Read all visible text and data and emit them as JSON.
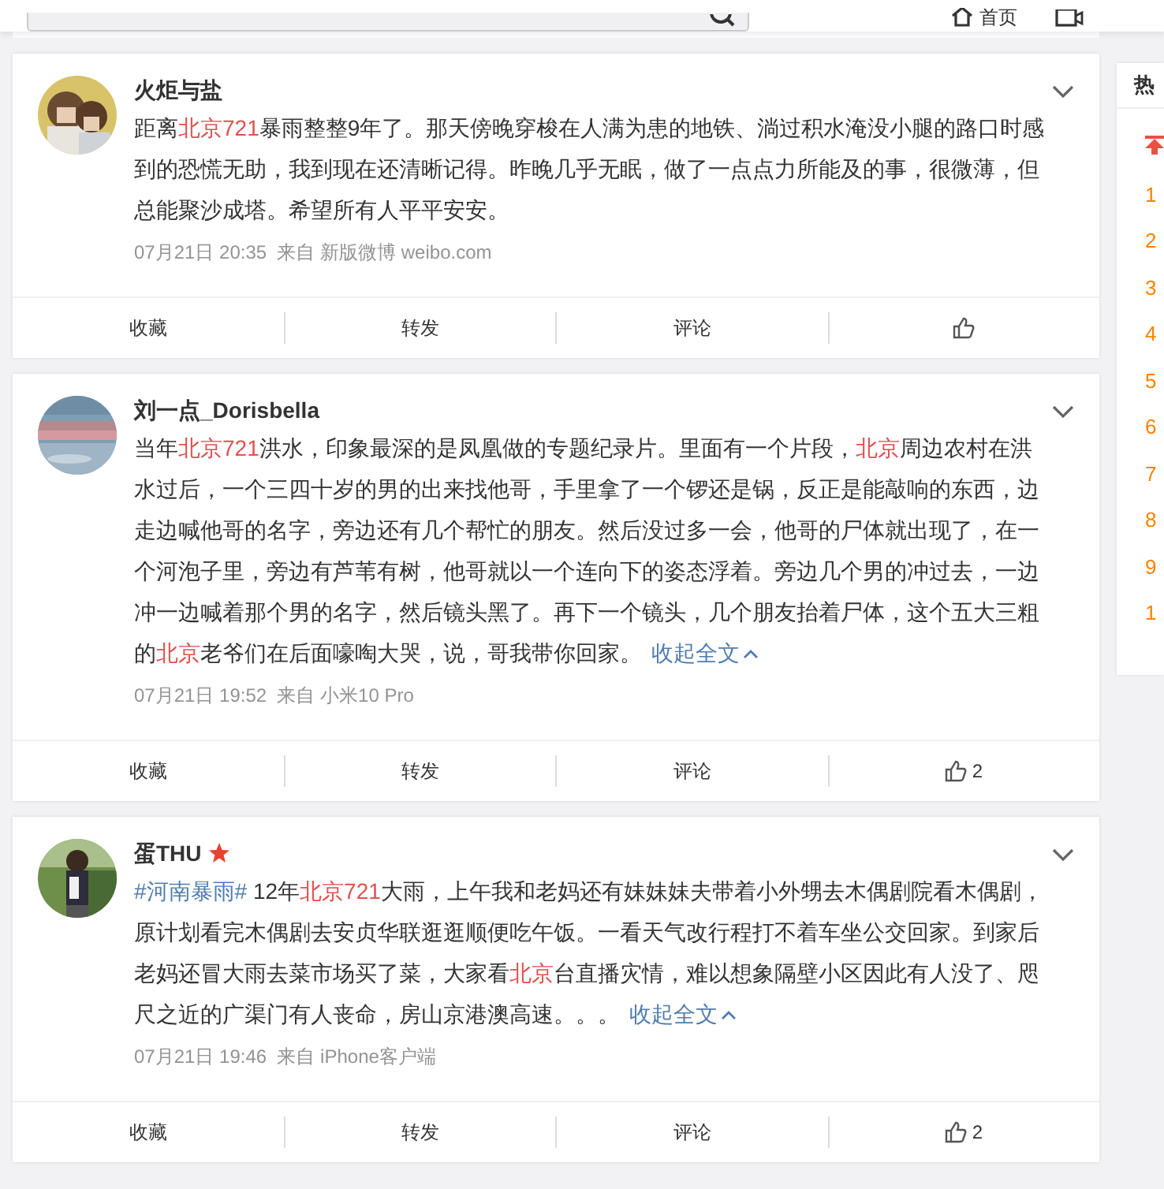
{
  "header": {
    "nav": [
      {
        "label": "首页",
        "kind": "home"
      },
      {
        "kind": "video"
      }
    ]
  },
  "posts": [
    {
      "author": "火炬与盐",
      "vip": false,
      "segments": [
        {
          "kind": "plain",
          "text": "距离"
        },
        {
          "kind": "keyword",
          "text": "北京721"
        },
        {
          "kind": "plain",
          "text": "暴雨整整9年了。那天傍晚穿梭在人满为患的地铁、淌过积水淹没小腿的路口时感到的恐慌无助，我到现在还清晰记得。昨晚几乎无眠，做了一点点力所能及的事，很微薄，但总能聚沙成塔。希望所有人平平安安。"
        }
      ],
      "meta": "07月21日 20:35  来自 新版微博 weibo.com",
      "actions": [
        "收藏",
        "转发",
        "评论"
      ]
    },
    {
      "author": "刘一点_Dorisbella",
      "vip": false,
      "segments": [
        {
          "kind": "plain",
          "text": "当年"
        },
        {
          "kind": "keyword",
          "text": "北京721"
        },
        {
          "kind": "plain",
          "text": "洪水，印象最深的是凤凰做的专题纪录片。里面有一个片段，"
        },
        {
          "kind": "keyword",
          "text": "北京"
        },
        {
          "kind": "plain",
          "text": "周边农村在洪水过后，一个三四十岁的男的出来找他哥，手里拿了一个锣还是锅，反正是能敲响的东西，边走边喊他哥的名字，旁边还有几个帮忙的朋友。然后没过多一会，他哥的尸体就出现了，在一个河泡子里，旁边有芦苇有树，他哥就以一个连向下的姿态浮着。旁边几个男的冲过去，一边冲一边喊着那个男的名字，然后镜头黑了。再下一个镜头，几个朋友抬着尸体，这个五大三粗的"
        },
        {
          "kind": "keyword",
          "text": "北京"
        },
        {
          "kind": "plain",
          "text": "老爷们在后面嚎啕大哭，说，哥我带你回家。"
        }
      ],
      "collapse": "收起全文",
      "meta": "07月21日 19:52  来自 小米10 Pro",
      "actions": [
        "收藏",
        "转发",
        "评论"
      ],
      "likes": "2"
    },
    {
      "author": "蛋THU",
      "vip": true,
      "segments": [
        {
          "kind": "topic",
          "text": "#河南暴雨#"
        },
        {
          "kind": "plain",
          "text": " 12年"
        },
        {
          "kind": "keyword",
          "text": "北京721"
        },
        {
          "kind": "plain",
          "text": "大雨，上午我和老妈还有妹妹妹夫带着小外甥去木偶剧院看木偶剧，原计划看完木偶剧去安贞华联逛逛顺便吃午饭。一看天气改行程打不着车坐公交回家。到家后老妈还冒大雨去菜市场买了菜，大家看"
        },
        {
          "kind": "keyword",
          "text": "北京"
        },
        {
          "kind": "plain",
          "text": "台直播灾情，难以想象隔壁小区因此有人没了、咫尺之近的广渠门有人丧命，房山京港澳高速。。。"
        }
      ],
      "collapse": "收起全文",
      "meta": "07月21日 19:46  来自 iPhone客户端",
      "actions": [
        "收藏",
        "转发",
        "评论"
      ],
      "likes": "2"
    }
  ],
  "sidebar": {
    "title": "热",
    "ranks": [
      "1",
      "2",
      "3",
      "4",
      "5",
      "6",
      "7",
      "8",
      "9",
      "1"
    ]
  }
}
